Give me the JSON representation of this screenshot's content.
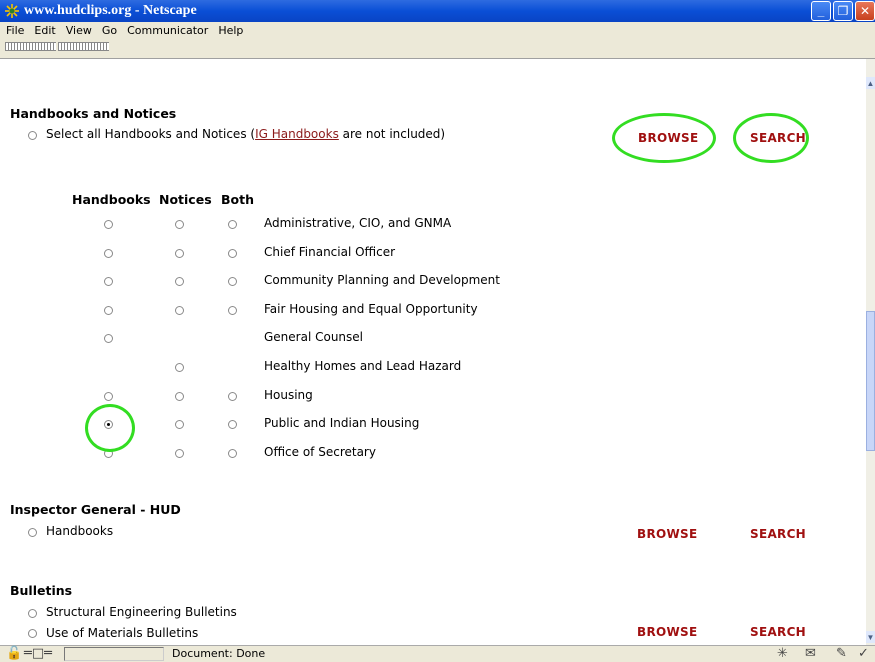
{
  "window": {
    "title": "www.hudclips.org - Netscape"
  },
  "menu": [
    "File",
    "Edit",
    "View",
    "Go",
    "Communicator",
    "Help"
  ],
  "handbooks_notices": {
    "heading": "Handbooks and Notices",
    "select_all_prefix": "Select all Handbooks and Notices (",
    "select_all_link": "IG Handbooks",
    "select_all_suffix": " are not included)",
    "browse": "BROWSE",
    "search": "SEARCH",
    "columns": [
      "Handbooks",
      "Notices",
      "Both"
    ],
    "rows": [
      {
        "label": "Administrative, CIO, and GNMA",
        "handbooks": true,
        "notices": true,
        "both": true
      },
      {
        "label": "Chief Financial Officer",
        "handbooks": true,
        "notices": true,
        "both": true
      },
      {
        "label": "Community Planning and Development",
        "handbooks": true,
        "notices": true,
        "both": true
      },
      {
        "label": "Fair Housing and Equal Opportunity",
        "handbooks": true,
        "notices": true,
        "both": true
      },
      {
        "label": "General Counsel",
        "handbooks": true,
        "notices": false,
        "both": false
      },
      {
        "label": "Healthy Homes and Lead Hazard",
        "handbooks": false,
        "notices": true,
        "both": false
      },
      {
        "label": "Housing",
        "handbooks": true,
        "notices": true,
        "both": true
      },
      {
        "label": "Public and Indian Housing",
        "handbooks": true,
        "notices": true,
        "both": true,
        "selected": "handbooks"
      },
      {
        "label": "Office of Secretary",
        "handbooks": true,
        "notices": true,
        "both": true
      }
    ]
  },
  "inspector_general": {
    "heading": "Inspector General - HUD",
    "item": "Handbooks",
    "browse": "BROWSE",
    "search": "SEARCH"
  },
  "bulletins": {
    "heading": "Bulletins",
    "items": [
      "Structural Engineering Bulletins",
      "Use of Materials Bulletins"
    ],
    "browse": "BROWSE",
    "search": "SEARCH"
  },
  "status": {
    "text": "Document: Done"
  },
  "colors": {
    "highlight_circle": "#33dd22",
    "action_text": "#a01010",
    "titlebar": "#0a4fd6"
  }
}
